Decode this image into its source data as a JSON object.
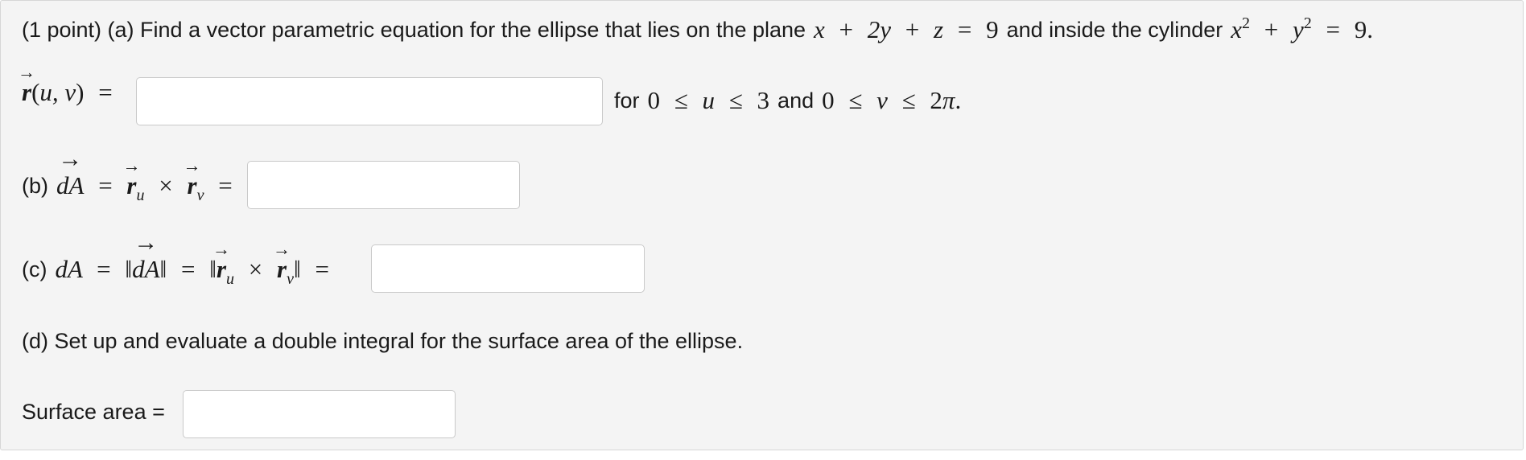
{
  "part_a": {
    "intro": "(1 point) (a) Find a vector parametric equation for the ellipse that lies on the plane",
    "plane_eq": "x + 2y + z = 9",
    "mid": "and inside the cylinder",
    "cylinder_eq": "x² + y² = 9.",
    "r_label": "r(u, v) =",
    "answer_value": "",
    "for_text": "for",
    "u_range": "0 ≤ u ≤ 3",
    "and_text": "and",
    "v_range": "0 ≤ v ≤ 2π."
  },
  "part_b": {
    "label": "(b)",
    "answer_value": ""
  },
  "part_c": {
    "label": "(c)",
    "answer_value": ""
  },
  "part_d": {
    "text": "(d) Set up and evaluate a double integral for the surface area of the ellipse.",
    "surface_label": "Surface area =",
    "answer_value": ""
  }
}
